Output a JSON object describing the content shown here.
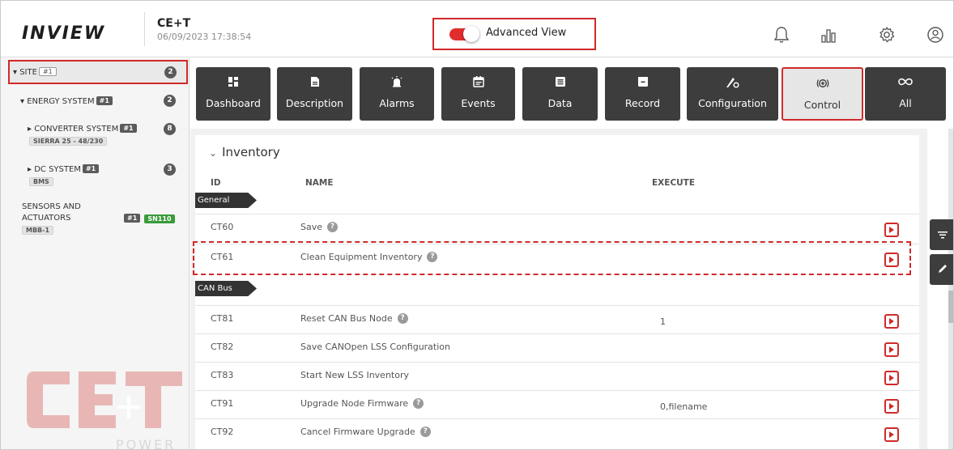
{
  "header": {
    "logo": "INVIEW",
    "site_name": "CE+T",
    "datetime": "06/09/2023 17:38:54",
    "advanced_view_label": "Advanced View",
    "advanced_view_on": true
  },
  "sidebar": {
    "site": {
      "label": "SITE",
      "tag": "#1",
      "count": "2"
    },
    "energy_system": {
      "label": "ENERGY SYSTEM",
      "tag": "#1",
      "count": "2"
    },
    "converter_system": {
      "label": "CONVERTER SYSTEM",
      "tag": "#1",
      "count": "8",
      "sub": "SIERRA 25 - 48/230"
    },
    "dc_system": {
      "label": "DC SYSTEM",
      "tag": "#1",
      "count": "3",
      "sub": "BMS"
    },
    "sensors": {
      "label_line1": "SENSORS AND",
      "label_line2": "ACTUATORS",
      "tag": "#1",
      "serial": "SN110",
      "sub": "MBB-1"
    },
    "watermark_text": "CE+T POWER"
  },
  "tabs": [
    {
      "label": "Dashboard",
      "icon": "dashboard-icon"
    },
    {
      "label": "Description",
      "icon": "document-icon"
    },
    {
      "label": "Alarms",
      "icon": "alarm-icon"
    },
    {
      "label": "Events",
      "icon": "calendar-icon"
    },
    {
      "label": "Data",
      "icon": "data-icon"
    },
    {
      "label": "Record",
      "icon": "record-icon"
    },
    {
      "label": "Configuration",
      "icon": "configuration-icon"
    },
    {
      "label": "Control",
      "icon": "control-icon",
      "active": true
    },
    {
      "label": "All",
      "icon": "infinity-icon"
    }
  ],
  "inventory": {
    "title": "Inventory",
    "columns": {
      "id": "ID",
      "name": "NAME",
      "execute": "EXECUTE"
    },
    "groups": [
      {
        "label": "General",
        "rows": [
          {
            "id": "CT60",
            "name": "Save",
            "help": true,
            "value": ""
          },
          {
            "id": "CT61",
            "name": "Clean Equipment Inventory",
            "help": true,
            "value": "",
            "highlighted": true
          }
        ]
      },
      {
        "label": "CAN Bus",
        "rows": [
          {
            "id": "CT81",
            "name": "Reset CAN Bus Node",
            "help": true,
            "value": "1"
          },
          {
            "id": "CT82",
            "name": "Save CANOpen LSS Configuration",
            "help": false,
            "value": ""
          },
          {
            "id": "CT83",
            "name": "Start New LSS Inventory",
            "help": false,
            "value": ""
          },
          {
            "id": "CT91",
            "name": "Upgrade Node Firmware",
            "help": true,
            "value": "0,filename"
          },
          {
            "id": "CT92",
            "name": "Cancel Firmware Upgrade",
            "help": true,
            "value": ""
          }
        ]
      }
    ]
  },
  "colors": {
    "accent_red": "#d02a2a",
    "tab_dark": "#3d3d3d",
    "tab_active": "#e6e6e6"
  }
}
